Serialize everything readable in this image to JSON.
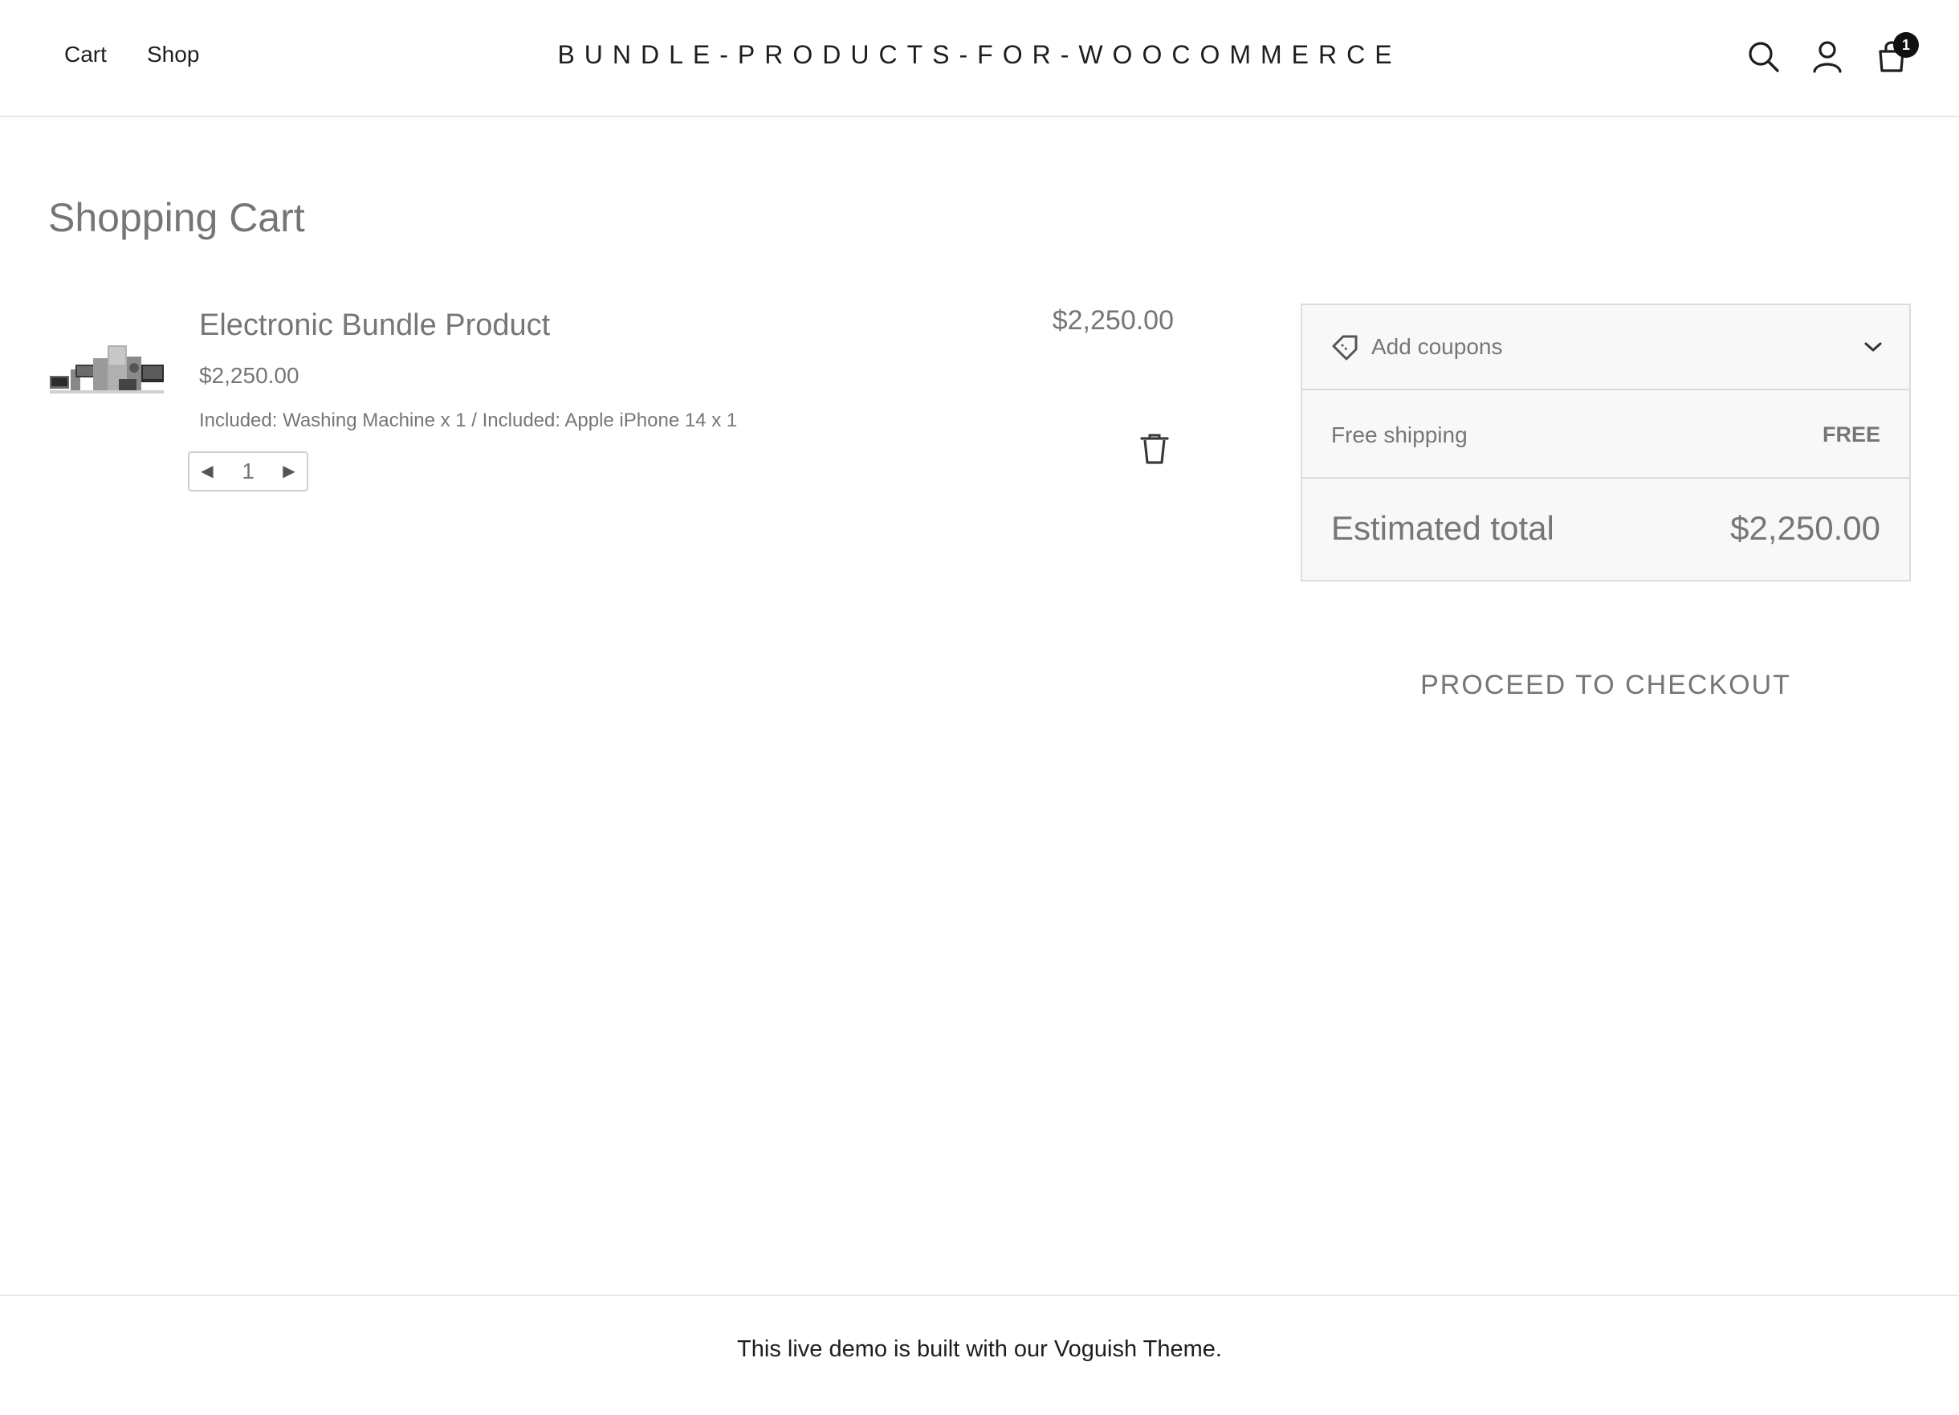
{
  "header": {
    "nav": [
      {
        "label": "Cart"
      },
      {
        "label": "Shop"
      }
    ],
    "site_title": "BUNDLE-PRODUCTS-FOR-WOOCOMMERCE",
    "icons": [
      "search-icon",
      "account-icon",
      "cart-icon"
    ],
    "cart_count": "1"
  },
  "main": {
    "page_title": "Shopping Cart",
    "cart_items": [
      {
        "name": "Electronic Bundle Product",
        "unit_price": "$2,250.00",
        "meta": "Included: Washing Machine x 1 / Included: Apple iPhone 14 x 1",
        "quantity": "1",
        "line_total": "$2,250.00"
      }
    ]
  },
  "sidebar": {
    "coupon_label": "Add coupons",
    "shipping_label": "Free shipping",
    "shipping_value": "FREE",
    "total_label": "Estimated total",
    "total_value": "$2,250.00",
    "checkout_label": "PROCEED TO CHECKOUT"
  },
  "footer": {
    "text_before": "This live demo is built with our ",
    "link_label": "Voguish Theme",
    "text_after": "."
  },
  "colors": {
    "text_dark": "#1e1e1e",
    "text_muted": "#767676",
    "panel_bg": "#f8f8f8",
    "border": "#dcdcdc",
    "badge": "#111111"
  }
}
